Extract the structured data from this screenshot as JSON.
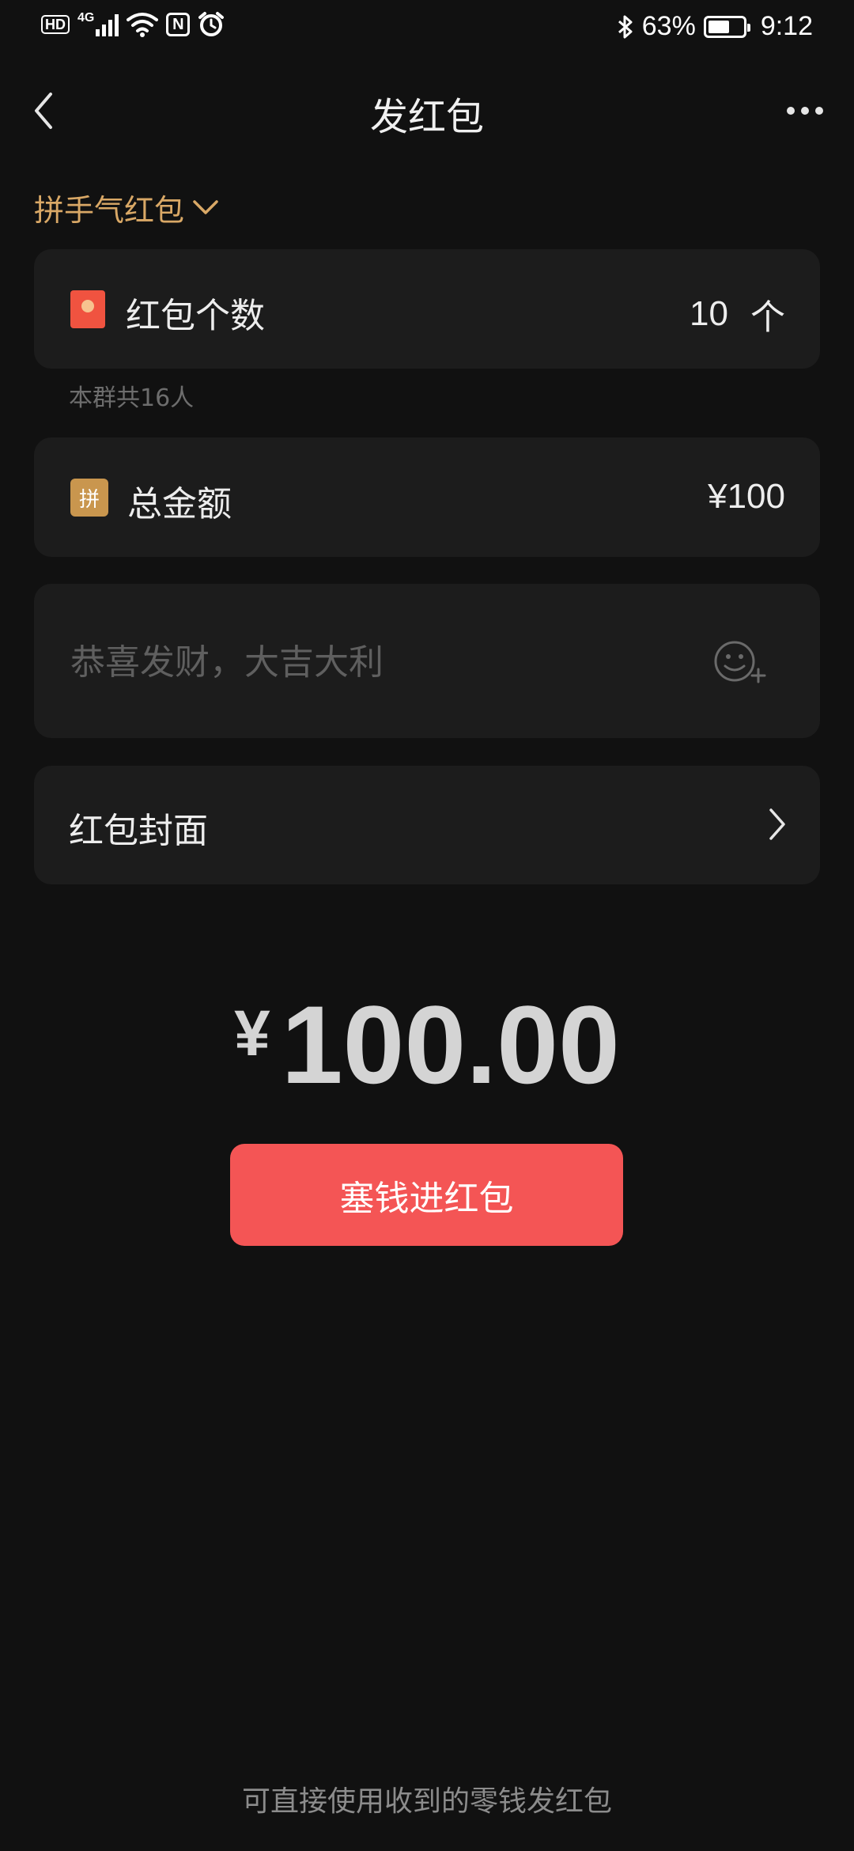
{
  "status_bar": {
    "hd": "HD",
    "network": "4G",
    "nfc": "N",
    "battery_percent": "63%",
    "battery_level": 0.63,
    "time": "9:12",
    "icons": [
      "signal-icon",
      "wifi-icon",
      "nfc-icon",
      "alarm-icon",
      "bluetooth-icon",
      "battery-icon"
    ]
  },
  "nav": {
    "title": "发红包",
    "back_icon": "chevron-left-icon",
    "more_icon": "more-dots-icon"
  },
  "packet_type": {
    "label": "拼手气红包",
    "icon": "chevron-down-icon"
  },
  "count_row": {
    "label": "红包个数",
    "value": "10",
    "unit": "个",
    "hint": "本群共16人"
  },
  "amount_row": {
    "badge": "拼",
    "label": "总金额",
    "value": "¥100"
  },
  "greeting": {
    "placeholder": "恭喜发财，大吉大利",
    "value": ""
  },
  "cover_row": {
    "label": "红包封面"
  },
  "total": {
    "symbol": "¥",
    "amount": "100.00"
  },
  "submit": {
    "label": "塞钱进红包"
  },
  "footer": {
    "note": "可直接使用收到的零钱发红包"
  },
  "colors": {
    "background": "#111111",
    "card": "#1c1c1c",
    "accent_gold": "#d9a866",
    "button_red": "#f45555"
  }
}
